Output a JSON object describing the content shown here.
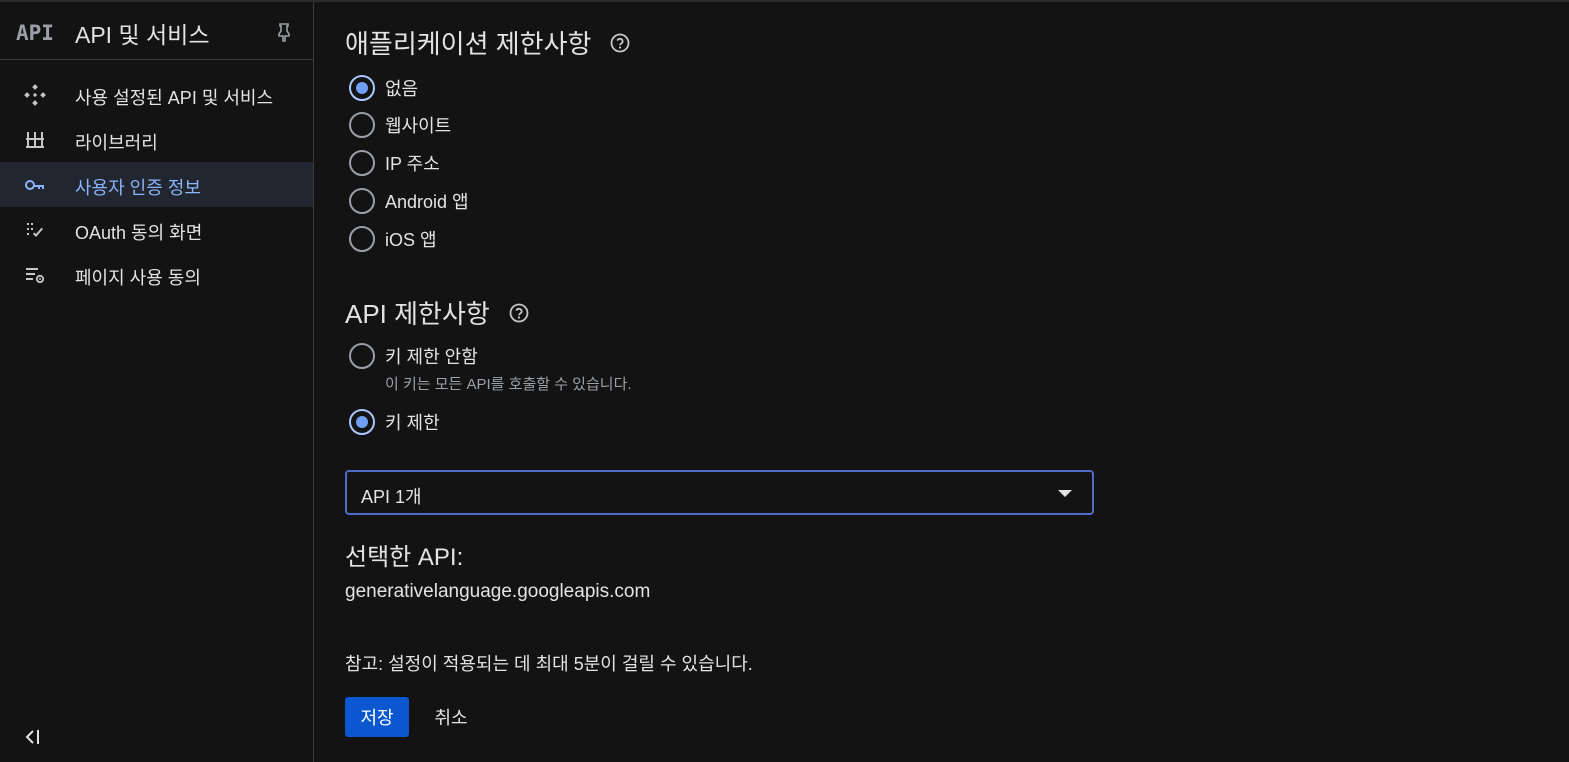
{
  "sidebar": {
    "logo_text": "API",
    "title": "API 및 서비스",
    "items": [
      {
        "label": "사용 설정된 API 및 서비스",
        "icon": "diamond-dots-icon",
        "active": false
      },
      {
        "label": "라이브러리",
        "icon": "library-icon",
        "active": false
      },
      {
        "label": "사용자 인증 정보",
        "icon": "key-icon",
        "active": true
      },
      {
        "label": "OAuth 동의 화면",
        "icon": "oauth-icon",
        "active": false
      },
      {
        "label": "페이지 사용 동의",
        "icon": "settings-list-icon",
        "active": false
      }
    ]
  },
  "app_restrictions": {
    "title": "애플리케이션 제한사항",
    "options": [
      {
        "label": "없음",
        "checked": true
      },
      {
        "label": "웹사이트",
        "checked": false
      },
      {
        "label": "IP 주소",
        "checked": false
      },
      {
        "label": "Android 앱",
        "checked": false
      },
      {
        "label": "iOS 앱",
        "checked": false
      }
    ]
  },
  "api_restrictions": {
    "title": "API 제한사항",
    "options": [
      {
        "label": "키 제한 안함",
        "sub": "이 키는 모든 API를 호출할 수 있습니다.",
        "checked": false
      },
      {
        "label": "키 제한",
        "checked": true
      }
    ],
    "select_value": "API 1개",
    "selected_title": "선택한 API:",
    "selected_api": "generativelanguage.googleapis.com"
  },
  "note": "참고: 설정이 적용되는 데 최대 5분이 걸릴 수 있습니다.",
  "buttons": {
    "save": "저장",
    "cancel": "취소"
  },
  "colors": {
    "accent": "#0b57d0",
    "active_text": "#8ab4f8",
    "background": "#131314"
  }
}
